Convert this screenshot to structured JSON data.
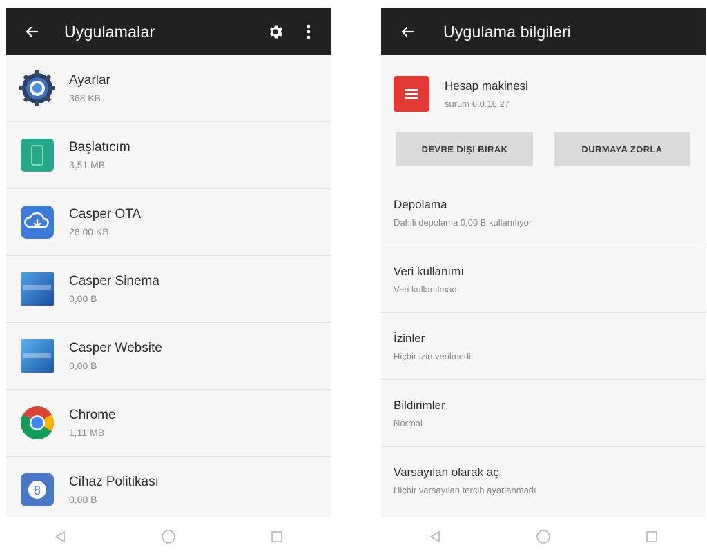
{
  "left": {
    "title": "Uygulamalar",
    "apps": [
      {
        "name": "Ayarlar",
        "size": "368 KB",
        "icon": "settings-gear-app-icon"
      },
      {
        "name": "Başlatıcım",
        "size": "3,51 MB",
        "icon": "launcher-app-icon"
      },
      {
        "name": "Casper OTA",
        "size": "28,00 KB",
        "icon": "cloud-update-app-icon"
      },
      {
        "name": "Casper Sinema",
        "size": "0,00 B",
        "icon": "casper-cinema-app-icon"
      },
      {
        "name": "Casper Website",
        "size": "0,00 B",
        "icon": "casper-website-app-icon"
      },
      {
        "name": "Chrome",
        "size": "1,11 MB",
        "icon": "chrome-app-icon"
      },
      {
        "name": "Cihaz Politikası",
        "size": "0,00 B",
        "icon": "device-policy-app-icon"
      }
    ]
  },
  "right": {
    "title": "Uygulama bilgileri",
    "app": {
      "name": "Hesap makinesi",
      "version": "sürüm 6.0.16.27",
      "icon": "calculator-app-icon"
    },
    "buttons": {
      "disable": "DEVRE DIŞI BIRAK",
      "force_stop": "DURMAYA ZORLA"
    },
    "settings": [
      {
        "title": "Depolama",
        "subtitle": "Dahili depolama 0,00 B kullanılıyor"
      },
      {
        "title": "Veri kullanımı",
        "subtitle": "Veri kullanılmadı"
      },
      {
        "title": "İzinler",
        "subtitle": "Hiçbir izin verilmedi"
      },
      {
        "title": "Bildirimler",
        "subtitle": "Normal"
      },
      {
        "title": "Varsayılan olarak aç",
        "subtitle": "Hiçbir varsayılan tercih ayarlanmadı"
      }
    ]
  },
  "colors": {
    "appbar": "#212121",
    "calculator": "#e53935",
    "button_bg": "#dadada"
  }
}
